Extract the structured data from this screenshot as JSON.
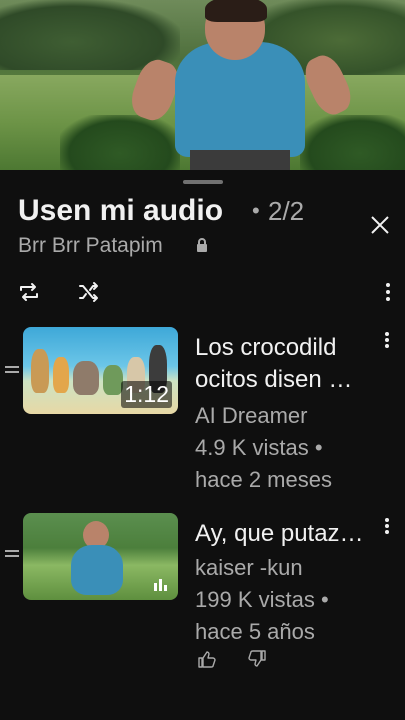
{
  "player": {
    "icon": "video-frame"
  },
  "playlist": {
    "title": "Usen mi audio",
    "separator": "•",
    "count": "2/2",
    "channel": "Brr Brr Patapim",
    "privacy_icon": "lock-icon"
  },
  "controls": {
    "repeat_icon": "repeat-icon",
    "shuffle_icon": "shuffle-icon",
    "menu_icon": "more-vert-icon",
    "close_icon": "close-icon"
  },
  "items": [
    {
      "title_line1": "Los crocodild",
      "title_line2": "ocitos disen …",
      "channel": "AI Dreamer",
      "views": "4.9 K vistas •",
      "age": "hace 2 meses",
      "duration": "1:12"
    },
    {
      "title_line1": "Ay, que putaz…",
      "channel": "kaiser -kun",
      "views": "199 K vistas •",
      "age": "hace 5 años",
      "now_playing_icon": "now-playing-icon"
    }
  ],
  "feedback": {
    "like_icon": "thumb-up-icon",
    "dislike_icon": "thumb-down-icon"
  }
}
